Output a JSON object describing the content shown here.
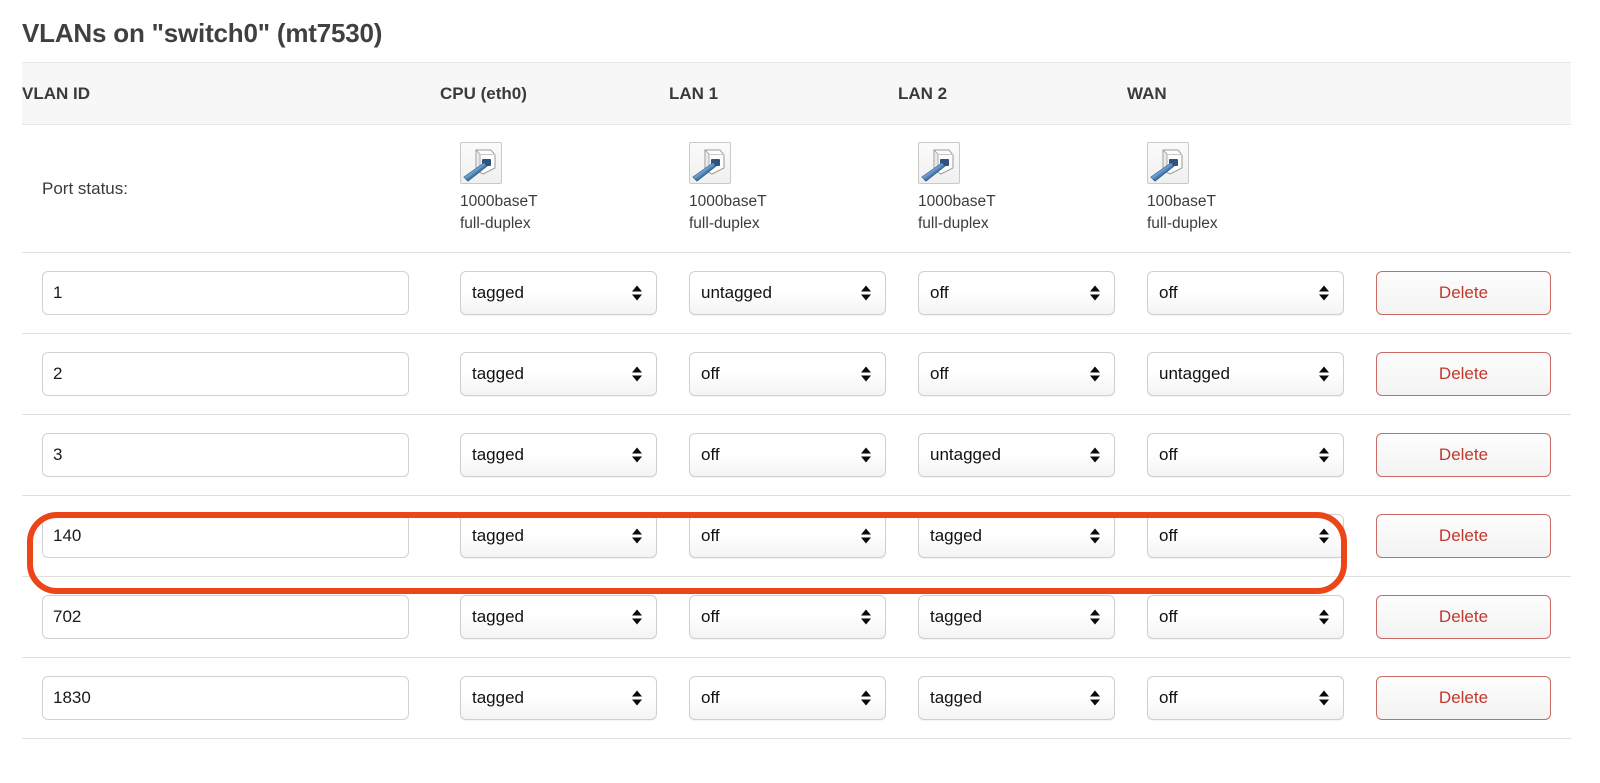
{
  "title": "VLANs on \"switch0\" (mt7530)",
  "columns": [
    "VLAN ID",
    "CPU (eth0)",
    "LAN 1",
    "LAN 2",
    "WAN"
  ],
  "port_status": {
    "label": "Port status:",
    "ports": [
      {
        "icon": "ethernet-port-icon",
        "speed": "1000baseT",
        "duplex": "full-duplex"
      },
      {
        "icon": "ethernet-port-icon",
        "speed": "1000baseT",
        "duplex": "full-duplex"
      },
      {
        "icon": "ethernet-port-icon",
        "speed": "1000baseT",
        "duplex": "full-duplex"
      },
      {
        "icon": "ethernet-port-icon",
        "speed": "100baseT",
        "duplex": "full-duplex"
      }
    ]
  },
  "select_options": [
    "off",
    "untagged",
    "tagged"
  ],
  "delete_label": "Delete",
  "vlan_id_placeholder": "",
  "rows": [
    {
      "vlan_id": "1",
      "cpu": "tagged",
      "lan1": "untagged",
      "lan2": "off",
      "wan": "off",
      "highlighted": false
    },
    {
      "vlan_id": "2",
      "cpu": "tagged",
      "lan1": "off",
      "lan2": "off",
      "wan": "untagged",
      "highlighted": false
    },
    {
      "vlan_id": "3",
      "cpu": "tagged",
      "lan1": "off",
      "lan2": "untagged",
      "wan": "off",
      "highlighted": false
    },
    {
      "vlan_id": "140",
      "cpu": "tagged",
      "lan1": "off",
      "lan2": "tagged",
      "wan": "off",
      "highlighted": true
    },
    {
      "vlan_id": "702",
      "cpu": "tagged",
      "lan1": "off",
      "lan2": "tagged",
      "wan": "off",
      "highlighted": false
    },
    {
      "vlan_id": "1830",
      "cpu": "tagged",
      "lan1": "off",
      "lan2": "tagged",
      "wan": "off",
      "highlighted": false
    }
  ],
  "colors": {
    "title": "#404040",
    "header_bg": "#f7f7f7",
    "border": "#e0e0e0",
    "delete_text": "#c0392b",
    "delete_border": "#c96a64",
    "highlight": "#ec4517",
    "cable_blue": "#3a6ea5"
  }
}
